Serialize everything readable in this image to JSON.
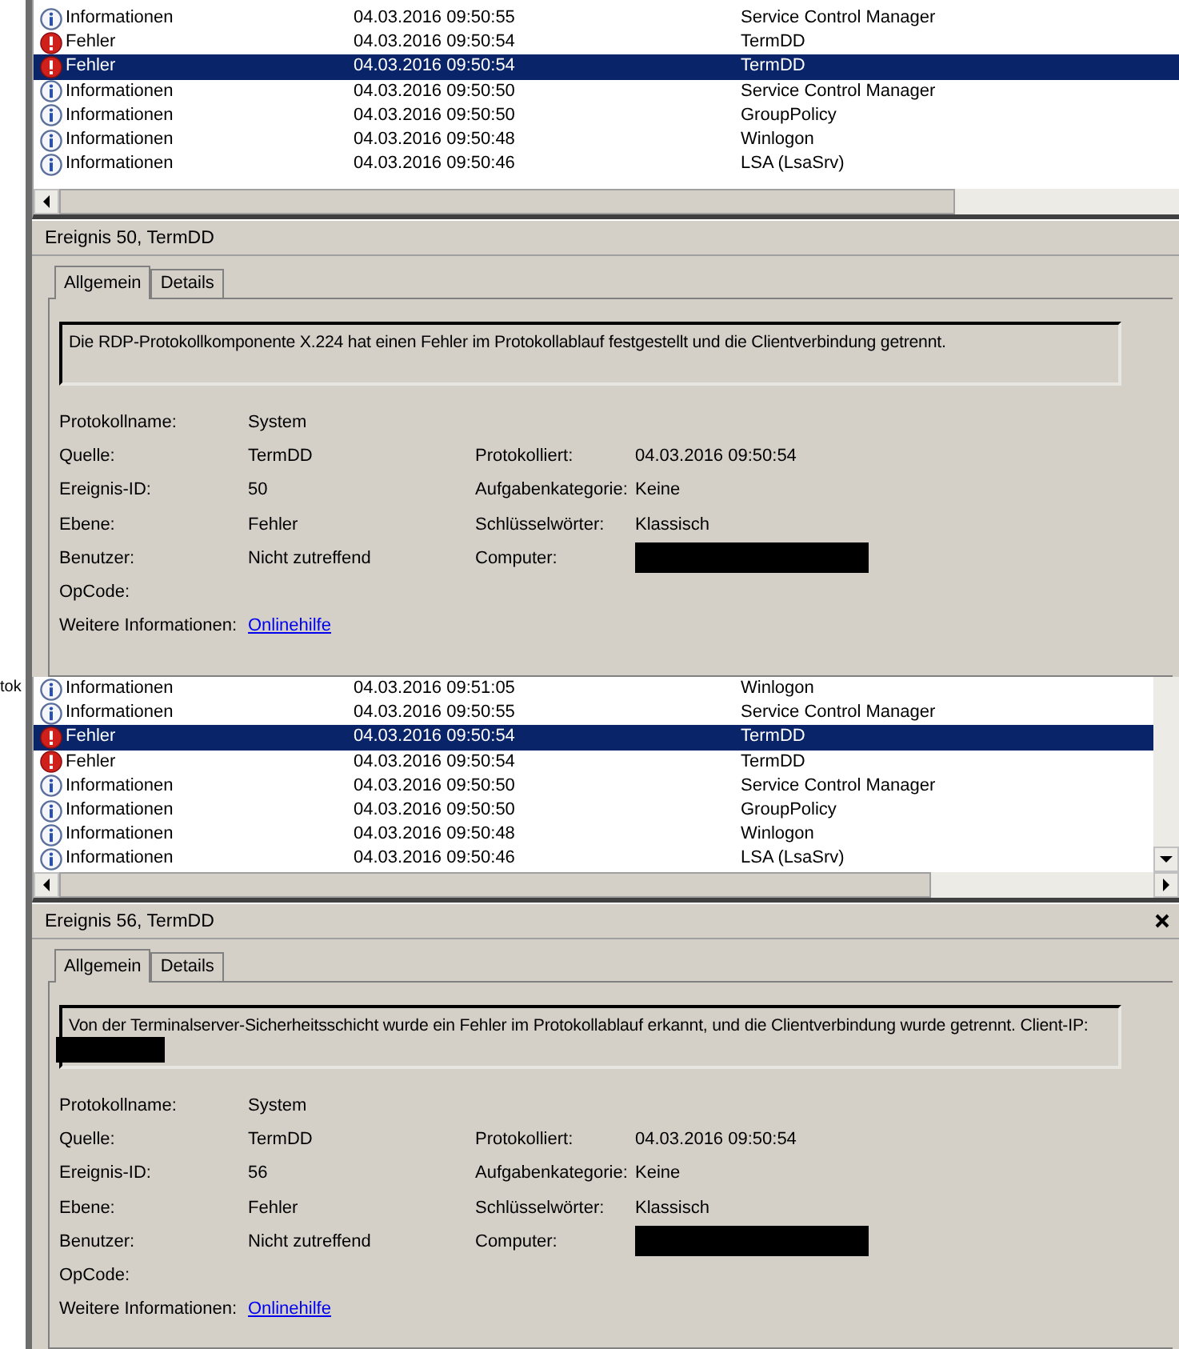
{
  "panes": [
    {
      "vertical_scrollbar": false,
      "rows": [
        {
          "kind": "info",
          "level": "Informationen",
          "date": "04.03.2016 09:50:55",
          "source": "Service Control Manager",
          "selected": false
        },
        {
          "kind": "error",
          "level": "Fehler",
          "date": "04.03.2016 09:50:54",
          "source": "TermDD",
          "selected": false
        },
        {
          "kind": "error",
          "level": "Fehler",
          "date": "04.03.2016 09:50:54",
          "source": "TermDD",
          "selected": true
        },
        {
          "kind": "info",
          "level": "Informationen",
          "date": "04.03.2016 09:50:50",
          "source": "Service Control Manager",
          "selected": false
        },
        {
          "kind": "info",
          "level": "Informationen",
          "date": "04.03.2016 09:50:50",
          "source": "GroupPolicy",
          "selected": false
        },
        {
          "kind": "info",
          "level": "Informationen",
          "date": "04.03.2016 09:50:48",
          "source": "Winlogon",
          "selected": false
        },
        {
          "kind": "info",
          "level": "Informationen",
          "date": "04.03.2016 09:50:46",
          "source": "LSA (LsaSrv)",
          "selected": false
        }
      ],
      "details": {
        "title": "Ereignis 50, TermDD",
        "closable": false,
        "tabs": [
          {
            "label": "Allgemein",
            "selected": true
          },
          {
            "label": "Details",
            "selected": false
          }
        ],
        "message": "Die RDP-Protokollkomponente X.224 hat einen Fehler im Protokollablauf festgestellt und die Clientverbindung getrennt.",
        "message_redacted": false,
        "field_rows": [
          [
            {
              "label": "Protokollname:",
              "kind": "text",
              "value": "System"
            }
          ],
          [
            {
              "label": "Quelle:",
              "kind": "text",
              "value": "TermDD"
            },
            {
              "label": "Protokolliert:",
              "kind": "text",
              "value": "04.03.2016 09:50:54"
            }
          ],
          [
            {
              "label": "Ereignis-ID:",
              "kind": "text",
              "value": "50"
            },
            {
              "label": "Aufgabenkategorie:",
              "kind": "text",
              "value": "Keine"
            }
          ],
          [
            {
              "label": "Ebene:",
              "kind": "text",
              "value": "Fehler"
            },
            {
              "label": "Schlüsselwörter:",
              "kind": "text",
              "value": "Klassisch"
            }
          ],
          [
            {
              "label": "Benutzer:",
              "kind": "text",
              "value": "Nicht zutreffend"
            },
            {
              "label": "Computer:",
              "kind": "redacted"
            }
          ],
          [
            {
              "label": "OpCode:",
              "kind": "empty"
            }
          ],
          [
            {
              "label": "Weitere Informationen:",
              "kind": "link",
              "value": "Onlinehilfe"
            }
          ]
        ]
      }
    },
    {
      "edge_text": "tok",
      "vertical_scrollbar": true,
      "rows": [
        {
          "kind": "info",
          "level": "Informationen",
          "date": "04.03.2016 09:51:05",
          "source": "Winlogon",
          "selected": false
        },
        {
          "kind": "info",
          "level": "Informationen",
          "date": "04.03.2016 09:50:55",
          "source": "Service Control Manager",
          "selected": false
        },
        {
          "kind": "error",
          "level": "Fehler",
          "date": "04.03.2016 09:50:54",
          "source": "TermDD",
          "selected": true
        },
        {
          "kind": "error",
          "level": "Fehler",
          "date": "04.03.2016 09:50:54",
          "source": "TermDD",
          "selected": false
        },
        {
          "kind": "info",
          "level": "Informationen",
          "date": "04.03.2016 09:50:50",
          "source": "Service Control Manager",
          "selected": false
        },
        {
          "kind": "info",
          "level": "Informationen",
          "date": "04.03.2016 09:50:50",
          "source": "GroupPolicy",
          "selected": false
        },
        {
          "kind": "info",
          "level": "Informationen",
          "date": "04.03.2016 09:50:48",
          "source": "Winlogon",
          "selected": false
        },
        {
          "kind": "info",
          "level": "Informationen",
          "date": "04.03.2016 09:50:46",
          "source": "LSA (LsaSrv)",
          "selected": false
        }
      ],
      "details": {
        "title": "Ereignis 56, TermDD",
        "closable": true,
        "tabs": [
          {
            "label": "Allgemein",
            "selected": true
          },
          {
            "label": "Details",
            "selected": false
          }
        ],
        "message": "Von der Terminalserver-Sicherheitsschicht wurde ein Fehler im Protokollablauf erkannt, und die Clientverbindung wurde getrennt. Client-IP:",
        "message_redacted": true,
        "field_rows": [
          [
            {
              "label": "Protokollname:",
              "kind": "text",
              "value": "System"
            }
          ],
          [
            {
              "label": "Quelle:",
              "kind": "text",
              "value": "TermDD"
            },
            {
              "label": "Protokolliert:",
              "kind": "text",
              "value": "04.03.2016 09:50:54"
            }
          ],
          [
            {
              "label": "Ereignis-ID:",
              "kind": "text",
              "value": "56"
            },
            {
              "label": "Aufgabenkategorie:",
              "kind": "text",
              "value": "Keine"
            }
          ],
          [
            {
              "label": "Ebene:",
              "kind": "text",
              "value": "Fehler"
            },
            {
              "label": "Schlüsselwörter:",
              "kind": "text",
              "value": "Klassisch"
            }
          ],
          [
            {
              "label": "Benutzer:",
              "kind": "text",
              "value": "Nicht zutreffend"
            },
            {
              "label": "Computer:",
              "kind": "redacted"
            }
          ],
          [
            {
              "label": "OpCode:",
              "kind": "empty"
            }
          ],
          [
            {
              "label": "Weitere Informationen:",
              "kind": "link",
              "value": "Onlinehilfe"
            }
          ]
        ]
      }
    }
  ]
}
